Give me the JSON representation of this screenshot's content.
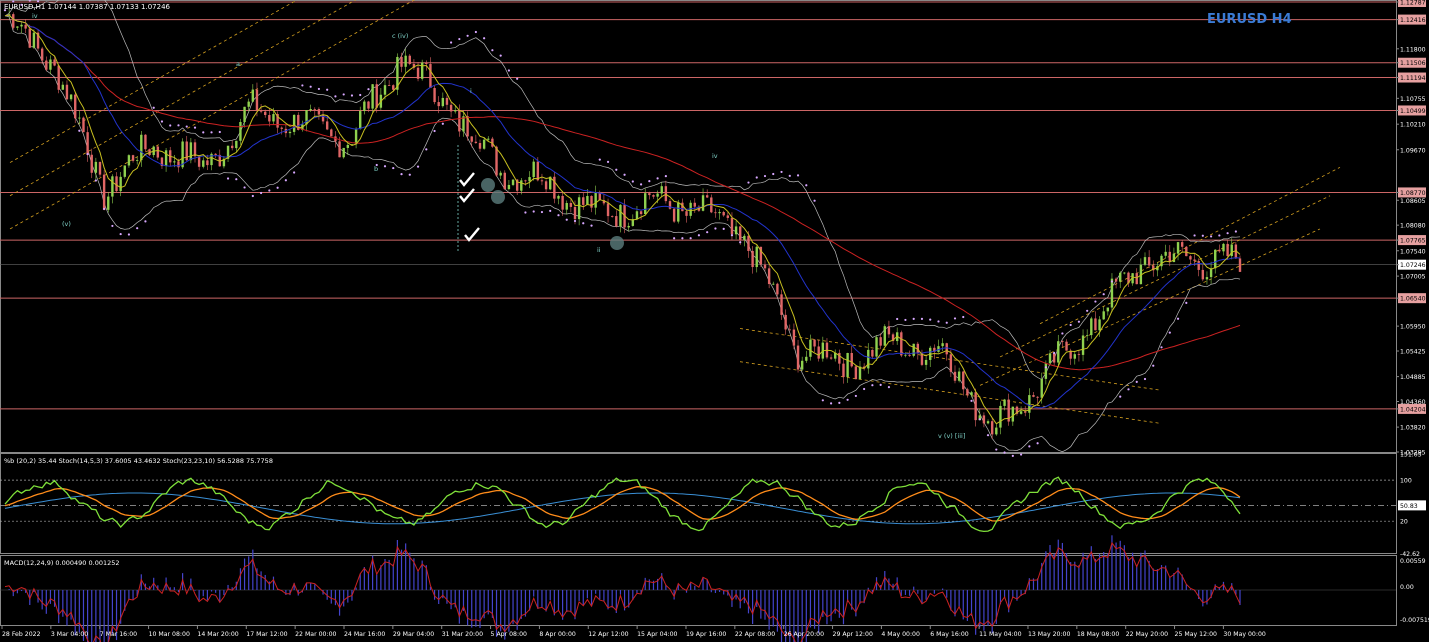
{
  "header": {
    "symbol_line": "EURUSD,H1  1.07144 1.07387 1.07133 1.07246",
    "watermark": "EURUSD H4"
  },
  "indicators": {
    "oscillator_label": "%b (20,2) 35.44  Stoch(14,5,3) 37.6005 43.4632  Stoch(23,23,10) 56.5288 75.7758",
    "macd_label": "MACD(12,24,9) 0.000490 0.001252"
  },
  "price_axis": {
    "ticks": [
      "1.12787",
      "1.12416",
      "1.11800",
      "1.11506",
      "1.11194",
      "1.10755",
      "1.10499",
      "1.10210",
      "1.09670",
      "1.08770",
      "1.08605",
      "1.08080",
      "1.07765",
      "1.07540",
      "1.07246",
      "1.07005",
      "1.06540",
      "1.05950",
      "1.05425",
      "1.04885",
      "1.04360",
      "1.04204",
      "1.03820",
      "1.03295"
    ],
    "highlighted": [
      "1.12787",
      "1.12416",
      "1.11506",
      "1.11194",
      "1.10499",
      "1.08770",
      "1.07765",
      "1.06540",
      "1.04204"
    ],
    "current": "1.07246"
  },
  "osc_axis": [
    "151.05",
    "100",
    "50.83",
    "20",
    "-42.62"
  ],
  "macd_axis": [
    "0.00559",
    "0.00",
    "-0.007519"
  ],
  "time_axis": [
    "28 Feb 2022",
    "3 Mar 04:00",
    "7 Mar 16:00",
    "10 Mar 08:00",
    "14 Mar 20:00",
    "17 Mar 12:00",
    "22 Mar 00:00",
    "24 Mar 16:00",
    "29 Mar 04:00",
    "31 Mar 20:00",
    "5 Apr 08:00",
    "8 Apr 00:00",
    "12 Apr 12:00",
    "15 Apr 04:00",
    "19 Apr 16:00",
    "22 Apr 08:00",
    "26 Apr 20:00",
    "29 Apr 12:00",
    "4 May 00:00",
    "6 May 16:00",
    "11 May 04:00",
    "13 May 20:00",
    "18 May 08:00",
    "22 May 20:00",
    "25 May 12:00",
    "30 May 00:00"
  ],
  "wave_labels": [
    "iv",
    "a",
    "c (iv)",
    "i",
    "b",
    "iv",
    "ii",
    "v (v) [iii]",
    "(v)"
  ],
  "colors": {
    "bull": "#8fd14f",
    "bear": "#e06666",
    "ma_long": "#cc2222",
    "ma_mid": "#2233cc",
    "ma_short": "#c8c020",
    "bands": "#bbbbbb",
    "hlines": "#cc6666",
    "channel": "#d4a020",
    "stoch_fast": "#7fe03a",
    "stoch_slow": "#ff8c1a",
    "macd_hist": "#4444cc",
    "macd_signal": "#cc2222",
    "watermark": "#3a7bd5",
    "axis_text": "#ffffff"
  },
  "chart_data": {
    "type": "line",
    "title": "EURUSD H4",
    "symbol": "EURUSD",
    "timeframe": "H4",
    "x": [
      "28 Feb 2022",
      "3 Mar 04:00",
      "7 Mar 16:00",
      "10 Mar 08:00",
      "14 Mar 20:00",
      "17 Mar 12:00",
      "22 Mar 00:00",
      "24 Mar 16:00",
      "29 Mar 04:00",
      "31 Mar 20:00",
      "5 Apr 08:00",
      "8 Apr 00:00",
      "12 Apr 12:00",
      "15 Apr 04:00",
      "19 Apr 16:00",
      "22 Apr 08:00",
      "26 Apr 20:00",
      "29 Apr 12:00",
      "4 May 00:00",
      "6 May 16:00",
      "11 May 04:00",
      "13 May 20:00",
      "18 May 08:00",
      "22 May 20:00",
      "25 May 12:00",
      "30 May 00:00"
    ],
    "series": [
      {
        "values": [
          1.125,
          1.115,
          1.088,
          1.098,
          1.093,
          1.105,
          1.102,
          1.099,
          1.116,
          1.106,
          1.093,
          1.09,
          1.083,
          1.086,
          1.084,
          1.078,
          1.055,
          1.052,
          1.056,
          1.054,
          1.038,
          1.048,
          1.06,
          1.073,
          1.074,
          1.0725
        ]
      }
    ],
    "ylim": [
      1.03295,
      1.12787
    ],
    "horizontal_levels": [
      1.12787,
      1.12416,
      1.11506,
      1.11194,
      1.10499,
      1.0877,
      1.07765,
      1.0654,
      1.04204
    ],
    "current_price": 1.07246
  }
}
